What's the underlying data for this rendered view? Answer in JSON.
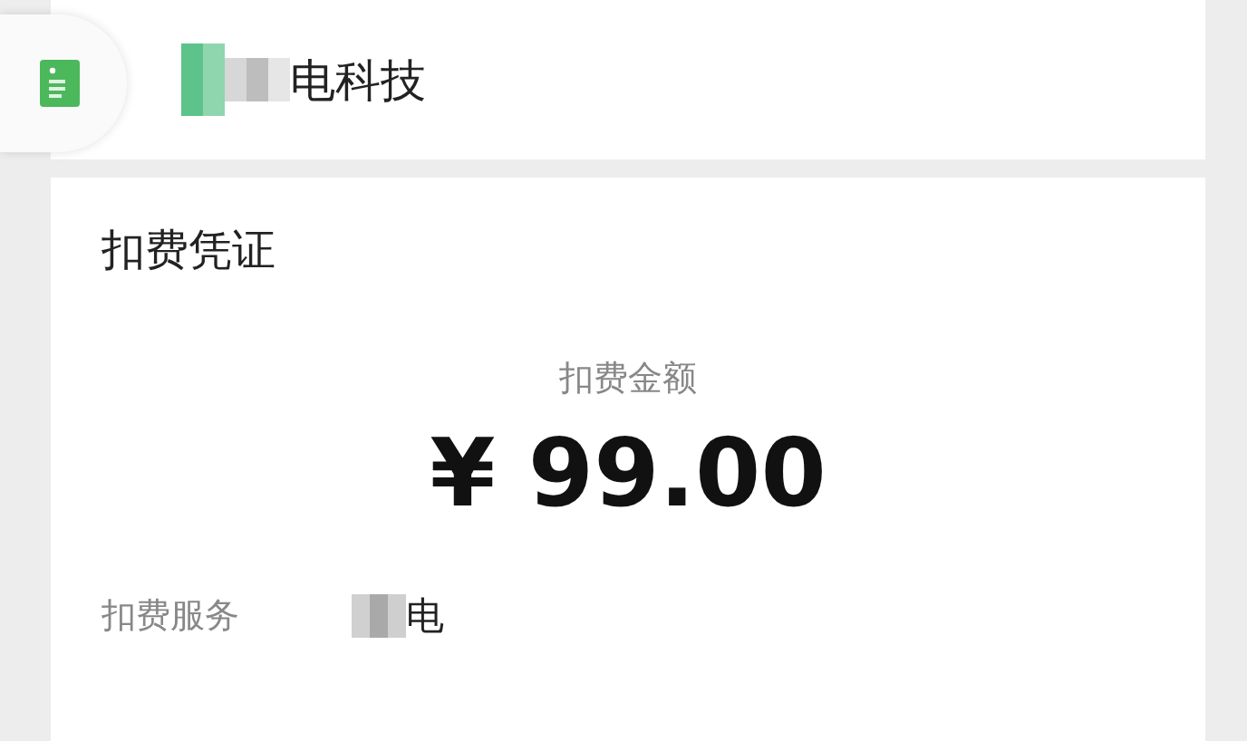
{
  "header": {
    "merchant_name": "电科技"
  },
  "receipt": {
    "title": "扣费凭证",
    "amount_label": "扣费金额",
    "amount": "¥ 99.00",
    "fields": [
      {
        "label": "扣费服务",
        "value": "电"
      }
    ]
  }
}
